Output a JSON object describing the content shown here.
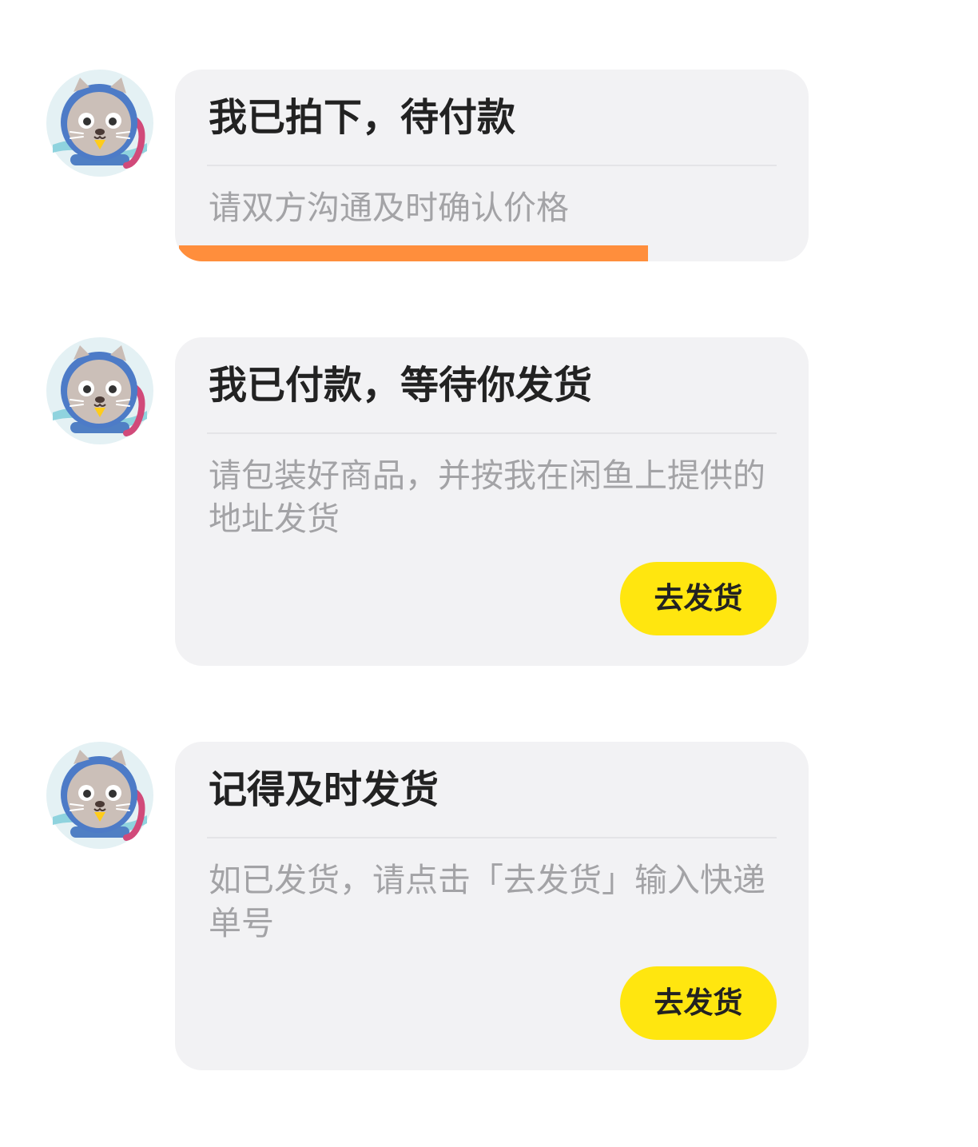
{
  "messages": [
    {
      "title": "我已拍下，待付款",
      "description": "请双方沟通及时确认价格",
      "progress": 0.74
    },
    {
      "title": "我已付款，等待你发货",
      "description": "请包装好商品，并按我在闲鱼上提供的地址发货",
      "button_label": "去发货"
    },
    {
      "title": "记得及时发货",
      "description": "如已发货，请点击「去发货」输入快递单号",
      "button_label": "去发货"
    }
  ],
  "avatar_icon": "otter-astronaut-avatar-icon",
  "colors": {
    "card_background": "#f2f2f4",
    "button_yellow": "#ffe60f",
    "progress_orange": "#ff8e3c",
    "title_text": "#222222",
    "description_text": "#a3a3a6"
  }
}
